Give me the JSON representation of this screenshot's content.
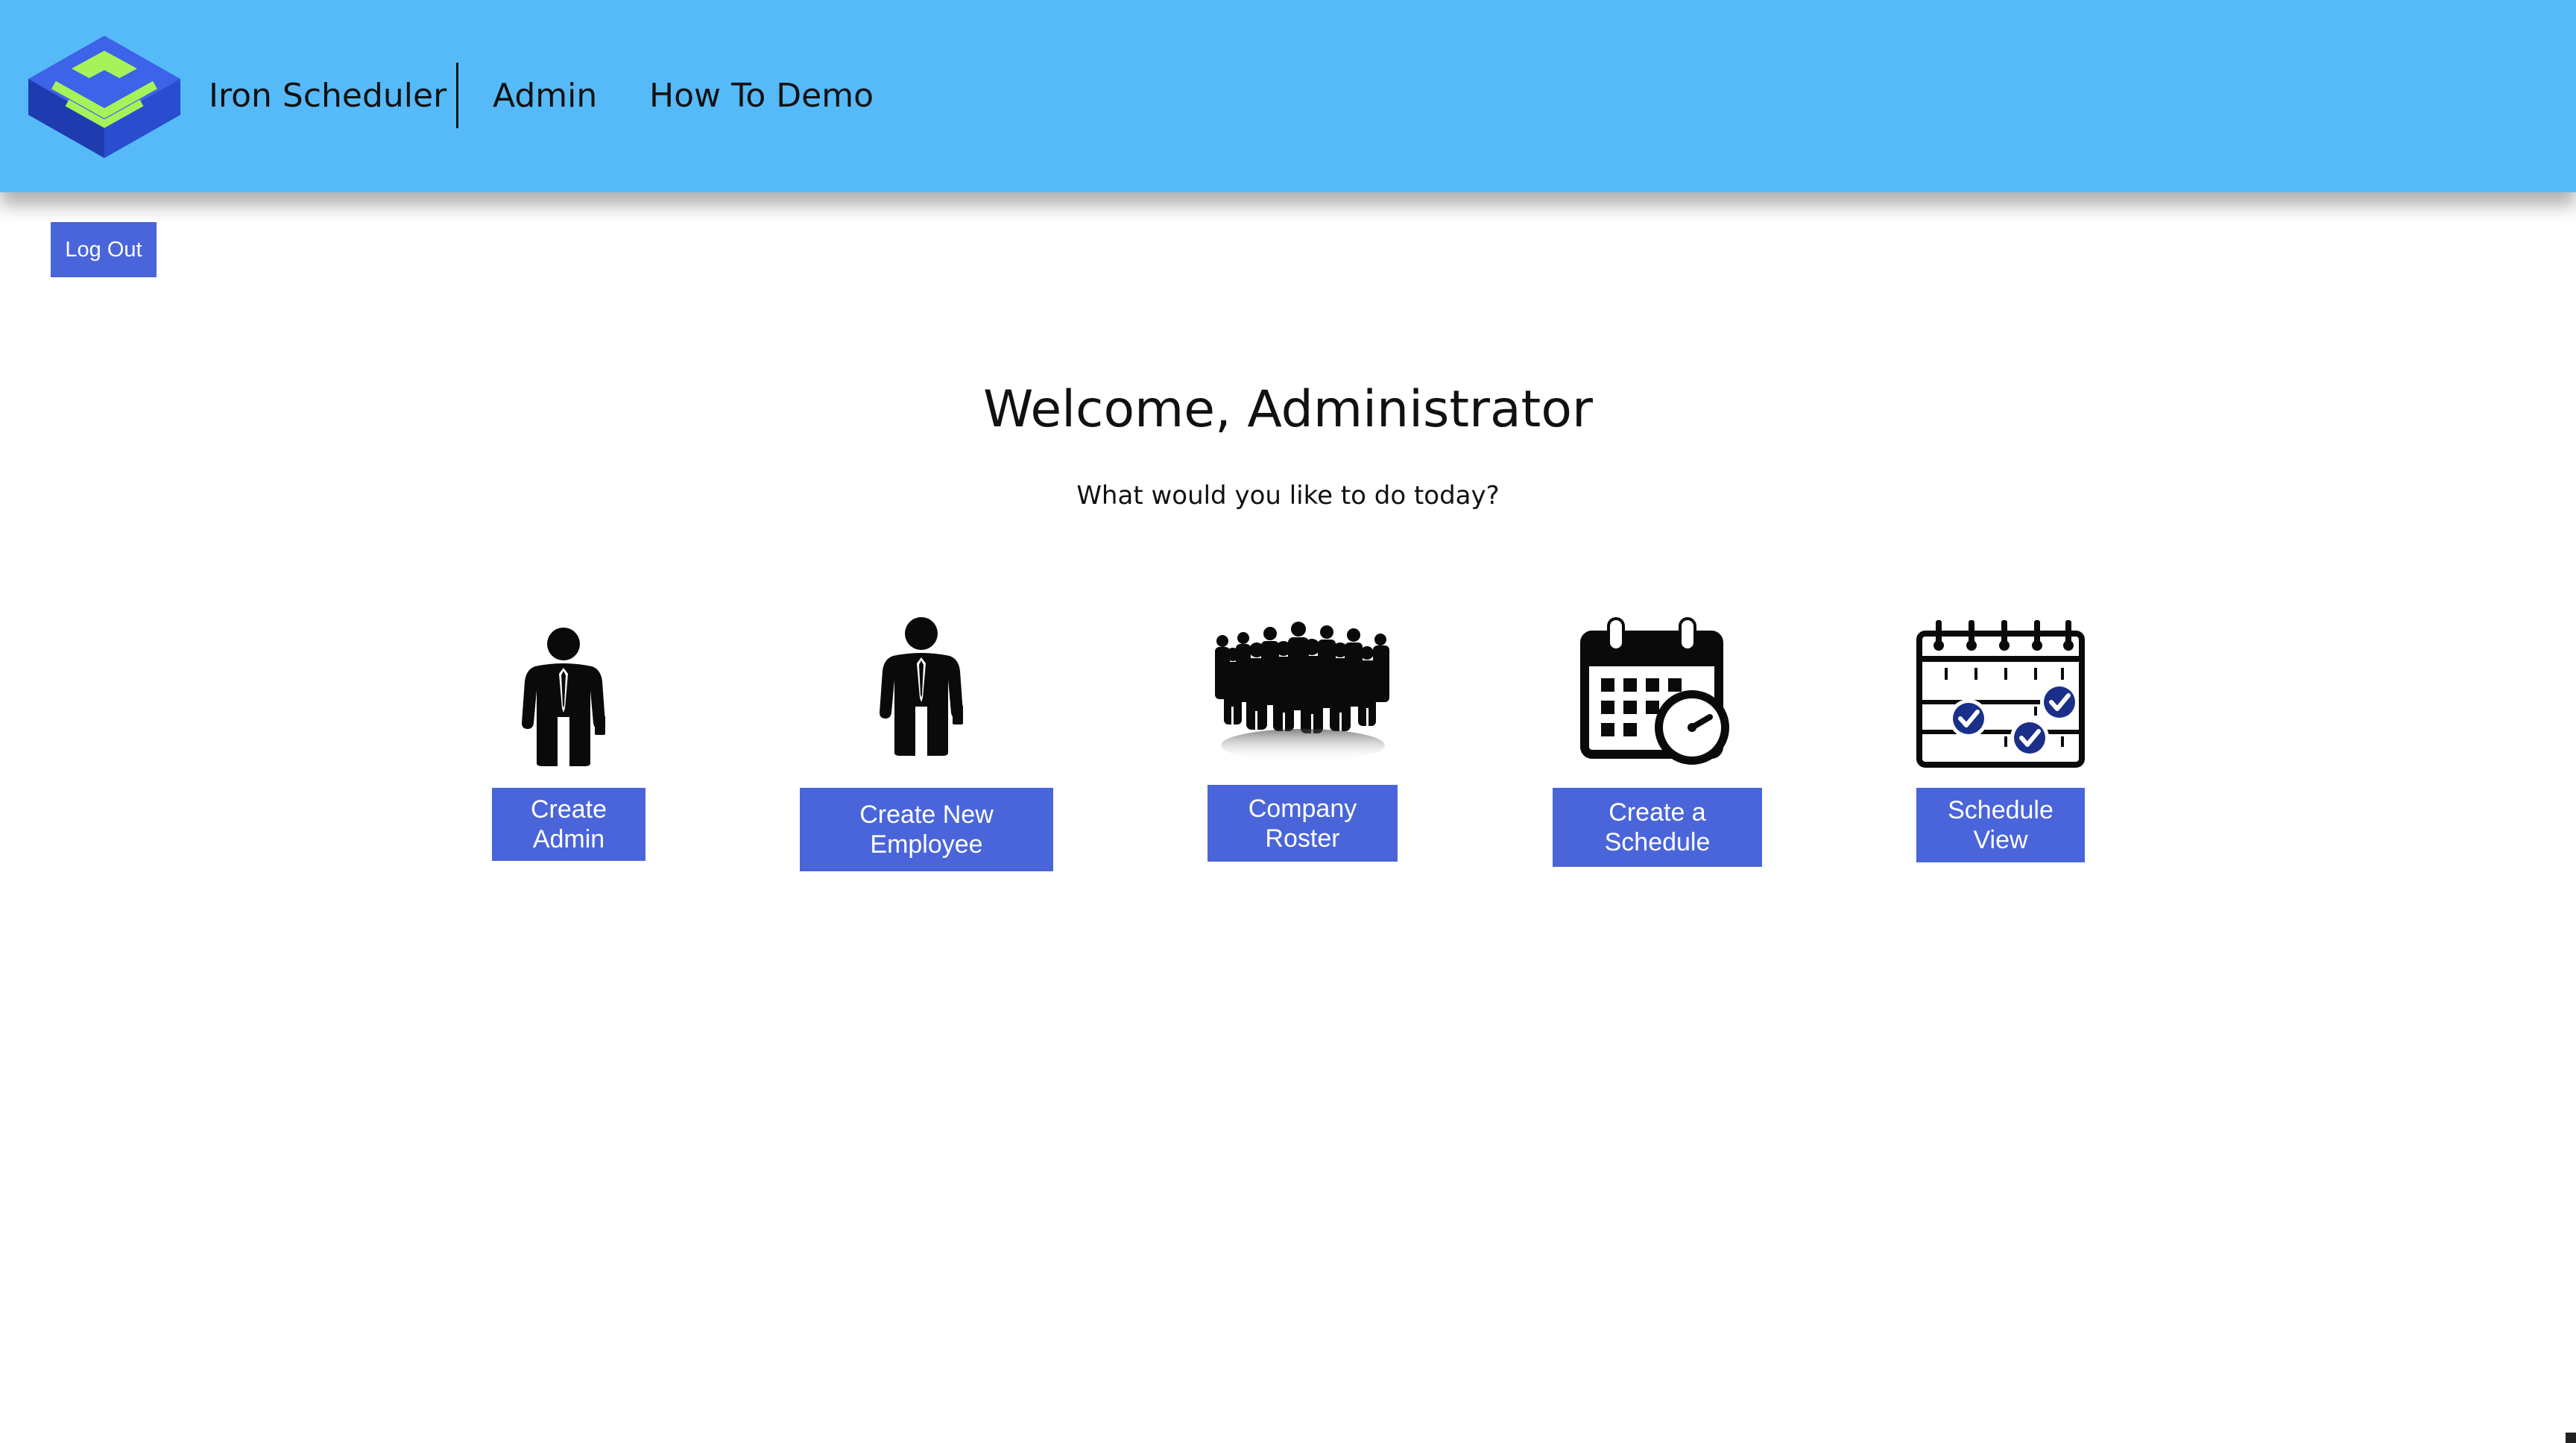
{
  "app": {
    "brand_name": "Iron Scheduler",
    "colors": {
      "navbar": "#56baf9",
      "button": "#4a65d9",
      "logo_blue": "#2d4fd6",
      "logo_green": "#a6f25a"
    }
  },
  "nav": {
    "admin_label": "Admin",
    "demo_label": "How To Demo"
  },
  "auth": {
    "logout_label": "Log Out"
  },
  "main": {
    "title": "Welcome, Administrator",
    "subtitle": "What would you like to do today?"
  },
  "actions": [
    {
      "label": "Create\nAdmin",
      "icon": "businessman-icon"
    },
    {
      "label": "Create New\nEmployee",
      "icon": "employee-icon"
    },
    {
      "label": "Company\nRoster",
      "icon": "group-people-icon"
    },
    {
      "label": "Create a\nSchedule",
      "icon": "calendar-clock-icon"
    },
    {
      "label": "Schedule\nView",
      "icon": "calendar-check-icon"
    }
  ]
}
